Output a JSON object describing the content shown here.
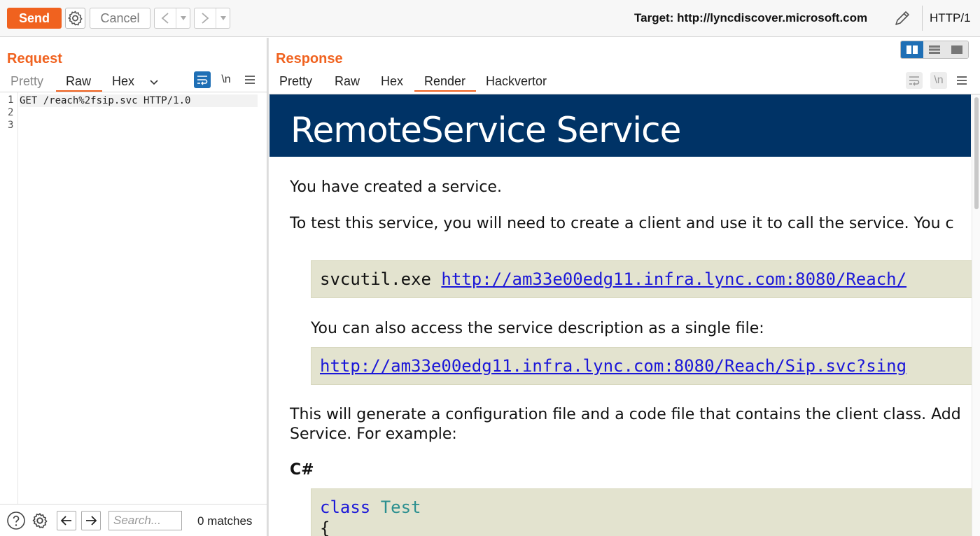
{
  "toolbar": {
    "send_label": "Send",
    "cancel_label": "Cancel",
    "target_label": "Target: http://lyncdiscover.microsoft.com",
    "protocol": "HTTP/1"
  },
  "request": {
    "title": "Request",
    "tabs": [
      "Pretty",
      "Raw",
      "Hex"
    ],
    "active_tab": "Raw",
    "newline_toggle": "\\n",
    "lines": [
      {
        "num": "1",
        "text": "GET /reach%2fsip.svc HTTP/1.0"
      },
      {
        "num": "2",
        "text": ""
      },
      {
        "num": "3",
        "text": ""
      }
    ],
    "search_placeholder": "Search...",
    "matches": "0 matches"
  },
  "response": {
    "title": "Response",
    "tabs": [
      "Pretty",
      "Raw",
      "Hex",
      "Render",
      "Hackvertor"
    ],
    "active_tab": "Render",
    "newline_toggle": "\\n",
    "render": {
      "banner_title": "RemoteService Service",
      "p1": "You have created a service.",
      "p2": "To test this service, you will need to create a client and use it to call the service. You c",
      "cmd_prefix": "svcutil.exe ",
      "cmd_link": "http://am33e00edg11.infra.lync.com:8080/Reach/",
      "p3": "You can also access the service description as a single file:",
      "single_link": "http://am33e00edg11.infra.lync.com:8080/Reach/Sip.svc?sing",
      "p4_line1": "This will generate a configuration file and a code file that contains the client class. Add",
      "p4_line2": "Service. For example:",
      "lang_heading": "C#",
      "code_kw": "class",
      "code_cls": "Test",
      "code_brace": "{"
    }
  },
  "colors": {
    "accent": "#f0621f",
    "banner": "#003366",
    "link": "#1b17d8",
    "code_bg": "#e3e3cf",
    "active_toggle": "#1f6fb5"
  }
}
